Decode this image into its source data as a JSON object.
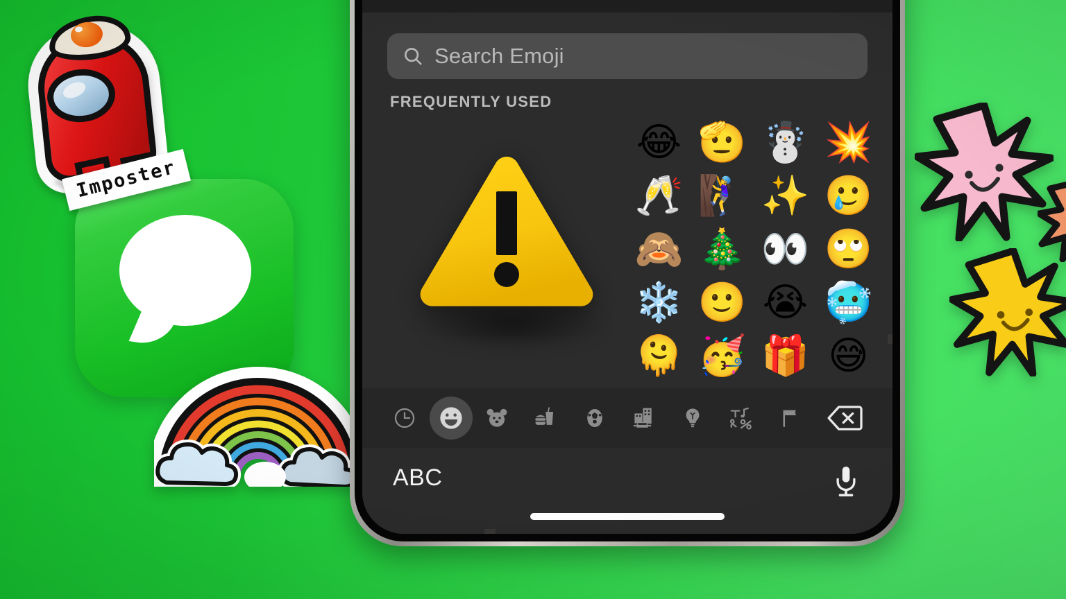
{
  "background": {
    "color_left": "#14bf2d",
    "color_right": "#4ae367"
  },
  "stickers": {
    "among_us": {
      "label": "Imposter",
      "body_color": "#e01414",
      "visor_color": "#b9d8ee",
      "hat": "fried-egg"
    },
    "rainbow": {
      "name": "rainbow-with-clouds-sticker",
      "bands": [
        "#e23b2e",
        "#f07c1e",
        "#f5b81c",
        "#f2e031",
        "#7ec44a",
        "#3fa9e0",
        "#9b5fc0"
      ]
    },
    "stars": [
      {
        "name": "pink-smiling-star",
        "color": "#f7b9cd"
      },
      {
        "name": "yellow-smiling-star",
        "color": "#f9cd17"
      },
      {
        "name": "orange-star-partial",
        "color": "#f2956a"
      }
    ],
    "messages_app_icon": {
      "name": "messages-app-icon",
      "color": "#1cc636",
      "bubble_color": "#ffffff"
    }
  },
  "phone": {
    "frame_color": "#b5b2ac",
    "bezel_color": "#050505",
    "screen_bg": "#1c1c1c"
  },
  "keyboard": {
    "search": {
      "placeholder": "Search Emoji",
      "icon": "search-icon",
      "value": ""
    },
    "section_title": "FREQUENTLY USED",
    "emoji_grid": {
      "columns": 8,
      "rows": 5,
      "items": [
        {
          "char": "",
          "name": "empty-slot"
        },
        {
          "char": "",
          "name": "empty-slot"
        },
        {
          "char": "",
          "name": "empty-slot"
        },
        {
          "char": "",
          "name": "empty-slot"
        },
        {
          "char": "😂",
          "name": "emoji-face-with-tears-of-joy"
        },
        {
          "char": "🫡",
          "name": "emoji-saluting-face"
        },
        {
          "char": "☃️",
          "name": "emoji-snowman"
        },
        {
          "char": "💥",
          "name": "emoji-collision"
        },
        {
          "char": "",
          "name": "empty-slot"
        },
        {
          "char": "",
          "name": "empty-slot"
        },
        {
          "char": "",
          "name": "empty-slot"
        },
        {
          "char": "",
          "name": "empty-slot"
        },
        {
          "char": "🥂",
          "name": "emoji-clinking-glasses"
        },
        {
          "char": "🧗‍♀️",
          "name": "emoji-woman-climbing"
        },
        {
          "char": "✨",
          "name": "emoji-sparkles"
        },
        {
          "char": "🥲",
          "name": "emoji-smiling-face-with-tear"
        },
        {
          "char": "",
          "name": "empty-slot"
        },
        {
          "char": "",
          "name": "empty-slot"
        },
        {
          "char": "",
          "name": "empty-slot"
        },
        {
          "char": "",
          "name": "empty-slot"
        },
        {
          "char": "🙈",
          "name": "emoji-see-no-evil-monkey"
        },
        {
          "char": "🎄",
          "name": "emoji-christmas-tree"
        },
        {
          "char": "👀",
          "name": "emoji-eyes"
        },
        {
          "char": "🙄",
          "name": "emoji-face-with-rolling-eyes"
        },
        {
          "char": "",
          "name": "empty-slot"
        },
        {
          "char": "",
          "name": "empty-slot"
        },
        {
          "char": "",
          "name": "empty-slot"
        },
        {
          "char": "",
          "name": "empty-slot"
        },
        {
          "char": "❄️",
          "name": "emoji-snowflake"
        },
        {
          "char": "🙂",
          "name": "emoji-slightly-smiling-face"
        },
        {
          "char": "😭",
          "name": "emoji-loudly-crying-face"
        },
        {
          "char": "🥶",
          "name": "emoji-cold-face"
        },
        {
          "char": "",
          "name": "empty-slot"
        },
        {
          "char": "",
          "name": "empty-slot"
        },
        {
          "char": "",
          "name": "empty-slot"
        },
        {
          "char": "",
          "name": "empty-slot"
        },
        {
          "char": "🫠",
          "name": "emoji-melting-face"
        },
        {
          "char": "🥳",
          "name": "emoji-partying-face"
        },
        {
          "char": "🎁",
          "name": "emoji-wrapped-gift"
        },
        {
          "char": "😅",
          "name": "emoji-grinning-face-with-sweat"
        }
      ]
    },
    "categories": [
      {
        "name": "category-recents",
        "icon": "clock-icon",
        "active": false
      },
      {
        "name": "category-smileys-people",
        "icon": "smiley-icon",
        "active": true
      },
      {
        "name": "category-animals-nature",
        "icon": "bear-icon",
        "active": false
      },
      {
        "name": "category-food-drink",
        "icon": "food-icon",
        "active": false
      },
      {
        "name": "category-activity",
        "icon": "soccer-ball-icon",
        "active": false
      },
      {
        "name": "category-travel-places",
        "icon": "buildings-car-icon",
        "active": false
      },
      {
        "name": "category-objects",
        "icon": "lightbulb-icon",
        "active": false
      },
      {
        "name": "category-symbols",
        "icon": "symbols-icon",
        "active": false
      },
      {
        "name": "category-flags",
        "icon": "flag-icon",
        "active": false
      }
    ],
    "delete_key": {
      "name": "delete-key",
      "icon": "delete-backward-icon"
    },
    "bottom": {
      "abc_label": "ABC",
      "mic": {
        "name": "dictation-key",
        "icon": "microphone-icon"
      }
    }
  },
  "overlay": {
    "warning": {
      "name": "warning-triangle",
      "symbol": "!",
      "fill_color": "#f5c518",
      "mark_color": "#111111"
    }
  }
}
